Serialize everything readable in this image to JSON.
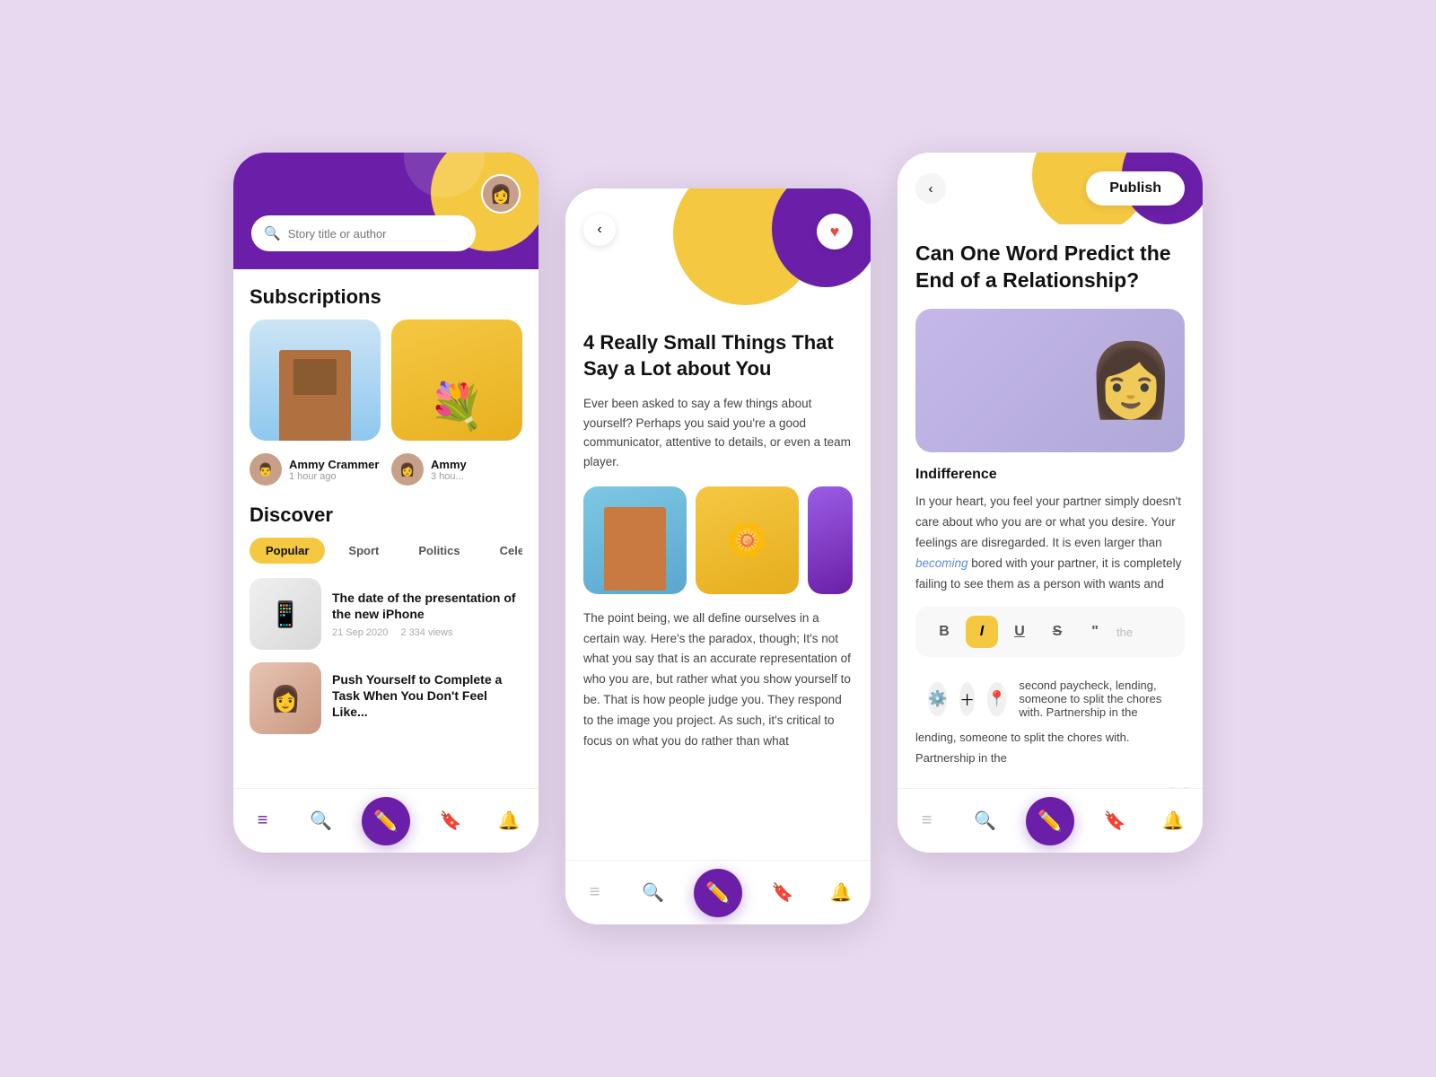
{
  "background": "#e8d8f0",
  "phone1": {
    "search_placeholder": "Story title or author",
    "subscriptions_title": "Subscriptions",
    "discover_title": "Discover",
    "tags": [
      {
        "label": "Popular",
        "active": true
      },
      {
        "label": "Sport",
        "active": false
      },
      {
        "label": "Politics",
        "active": false
      },
      {
        "label": "Celebrities",
        "active": false
      }
    ],
    "authors": [
      {
        "name": "Ammy Crammer",
        "time": "1 hour ago"
      },
      {
        "name": "Ammy",
        "time": "3 hou..."
      }
    ],
    "articles": [
      {
        "title": "The date of the presentation of the new iPhone",
        "date": "21 Sep 2020",
        "views": "2 334 views",
        "thumb_type": "iphone"
      },
      {
        "title": "Push Yourself to Complete a Task When You Don't Feel Like...",
        "date": "",
        "views": "",
        "thumb_type": "woman"
      }
    ],
    "nav": [
      "home",
      "search",
      "write",
      "bookmark",
      "bell"
    ]
  },
  "phone2": {
    "article_title": "4 Really Small Things That Say a Lot about You",
    "article_excerpt": "Ever been asked to say a few things about yourself? Perhaps you said you're a good communicator, attentive to details, or even a team player.",
    "article_body": "The point being, we all define ourselves in a certain way. Here's the paradox, though; It's not what you say that is an accurate representation of who you are, but rather what you show yourself to be. That is how people judge you. They respond to the image you project. As such, it's critical to focus on what you do rather than what",
    "heart_icon": "♥",
    "back_icon": "‹"
  },
  "phone3": {
    "publish_label": "Publish",
    "article_title": "Can One Word Predict the End of a Relationship?",
    "section_header": "Indifference",
    "article_body": "In your heart, you feel your partner simply doesn't care about who you are or what you desire. Your feelings are disregarded. It is even larger than becoming bored with your partner, it is completely failing to see them as a person with wants and",
    "highlighted_word": "becoming",
    "toolbar_buttons": [
      "B",
      "I",
      "U",
      "S",
      "\""
    ],
    "action_icons": [
      "gear",
      "plus",
      "location"
    ],
    "body_continuation": "second paycheck, lending, someone to split the chores with. Partnership in the",
    "back_icon": "‹",
    "slash_decoration": "//"
  }
}
